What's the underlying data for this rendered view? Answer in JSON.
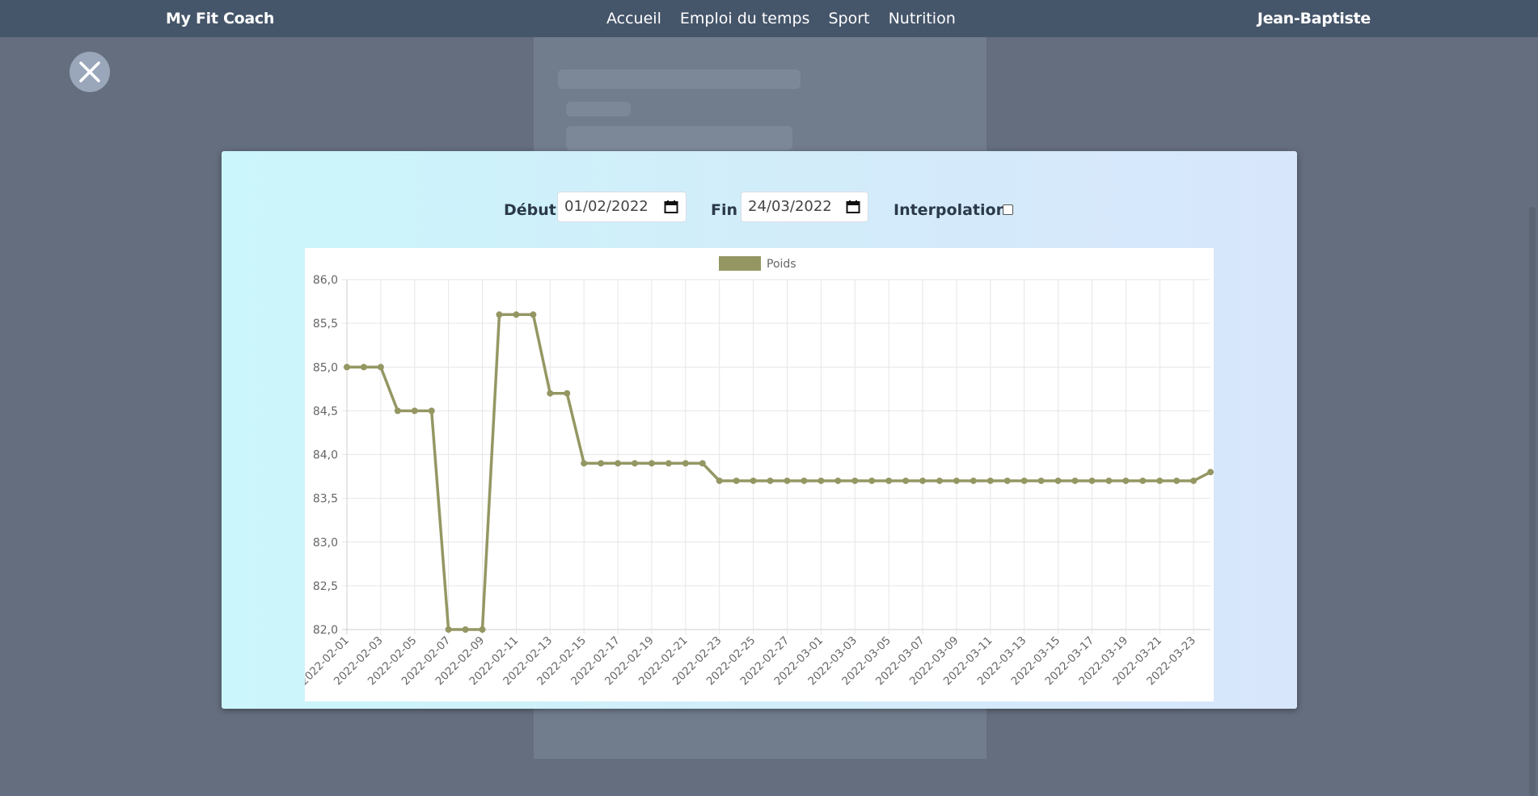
{
  "navbar": {
    "brand": "My Fit Coach",
    "links": [
      "Accueil",
      "Emploi du temps",
      "Sport",
      "Nutrition"
    ],
    "user": "Jean-Baptiste"
  },
  "icons": {
    "close": "close-icon",
    "calendar": "calendar-icon"
  },
  "colors": {
    "navbar": "#45556a",
    "series": "#959763",
    "modal_gradient": [
      "#cbf6fb",
      "#d8e6fb"
    ]
  },
  "filters": {
    "start_label": "Début",
    "start_value": "01/02/2022",
    "end_label": "Fin",
    "end_value": "24/03/2022",
    "interpolation_label": "Interpolation",
    "interpolation_checked": false
  },
  "chart_data": {
    "type": "line",
    "x_dates": [
      "2022-02-01",
      "2022-02-02",
      "2022-02-03",
      "2022-02-04",
      "2022-02-05",
      "2022-02-06",
      "2022-02-07",
      "2022-02-08",
      "2022-02-09",
      "2022-02-10",
      "2022-02-11",
      "2022-02-12",
      "2022-02-13",
      "2022-02-14",
      "2022-02-15",
      "2022-02-16",
      "2022-02-17",
      "2022-02-18",
      "2022-02-19",
      "2022-02-20",
      "2022-02-21",
      "2022-02-22",
      "2022-02-23",
      "2022-02-24",
      "2022-02-25",
      "2022-02-26",
      "2022-02-27",
      "2022-02-28",
      "2022-03-01",
      "2022-03-02",
      "2022-03-03",
      "2022-03-04",
      "2022-03-05",
      "2022-03-06",
      "2022-03-07",
      "2022-03-08",
      "2022-03-09",
      "2022-03-10",
      "2022-03-11",
      "2022-03-12",
      "2022-03-13",
      "2022-03-14",
      "2022-03-15",
      "2022-03-16",
      "2022-03-17",
      "2022-03-18",
      "2022-03-19",
      "2022-03-20",
      "2022-03-21",
      "2022-03-22",
      "2022-03-23",
      "2022-03-24"
    ],
    "x_tick_labels": [
      "2022-02-01",
      "2022-02-03",
      "2022-02-05",
      "2022-02-07",
      "2022-02-09",
      "2022-02-11",
      "2022-02-13",
      "2022-02-15",
      "2022-02-17",
      "2022-02-19",
      "2022-02-21",
      "2022-02-23",
      "2022-02-25",
      "2022-02-27",
      "2022-03-01",
      "2022-03-03",
      "2022-03-05",
      "2022-03-07",
      "2022-03-09",
      "2022-03-11",
      "2022-03-13",
      "2022-03-15",
      "2022-03-17",
      "2022-03-19",
      "2022-03-21",
      "2022-03-23"
    ],
    "y_ticks": [
      "86,0",
      "85,5",
      "85,0",
      "84,5",
      "84,0",
      "83,5",
      "83,0",
      "82,5",
      "82,0"
    ],
    "ylim": [
      82.0,
      86.0
    ],
    "series": [
      {
        "name": "Poids",
        "values": [
          85.0,
          85.0,
          85.0,
          84.5,
          84.5,
          84.5,
          82.0,
          82.0,
          82.0,
          85.6,
          85.6,
          85.6,
          84.7,
          84.7,
          83.9,
          83.9,
          83.9,
          83.9,
          83.9,
          83.9,
          83.9,
          83.9,
          83.7,
          83.7,
          83.7,
          83.7,
          83.7,
          83.7,
          83.7,
          83.7,
          83.7,
          83.7,
          83.7,
          83.7,
          83.7,
          83.7,
          83.7,
          83.7,
          83.7,
          83.7,
          83.7,
          83.7,
          83.7,
          83.7,
          83.7,
          83.7,
          83.7,
          83.7,
          83.7,
          83.7,
          83.7,
          83.8
        ]
      }
    ],
    "legend": "top",
    "grid": true
  }
}
